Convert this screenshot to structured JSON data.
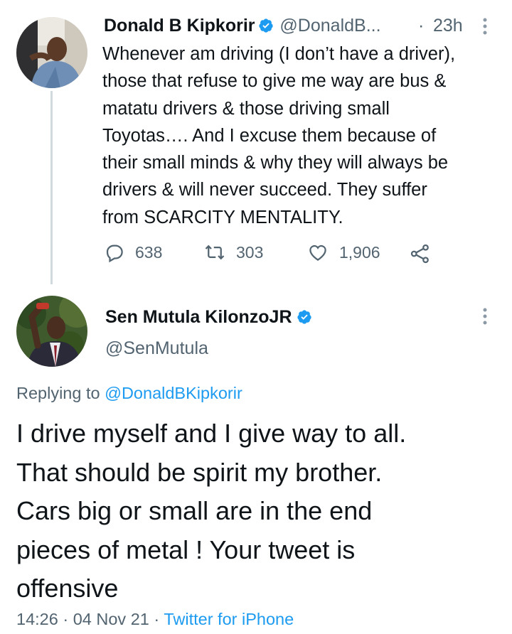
{
  "tweet1": {
    "display_name": "Donald B Kipkorir",
    "handle": "@DonaldB...",
    "separator": "·",
    "time": "23h",
    "body_lines": [
      "Whenever am driving (I don’t have a driver),",
      "those that refuse to give me way are bus &",
      "matatu drivers & those driving small",
      "Toyotas…. And I excuse them because of",
      "their small minds & why they will always be",
      "drivers & will never succeed. They suffer",
      "from SCARCITY MENTALITY."
    ],
    "reply_count": "638",
    "retweet_count": "303",
    "like_count": "1,906"
  },
  "tweet2": {
    "display_name": "Sen Mutula KilonzoJR",
    "handle": "@SenMutula",
    "replying_prefix": "Replying to",
    "replying_to": "@DonaldBKipkorir",
    "body_lines": [
      "I drive myself and I give way to all.",
      "That should be spirit my brother.",
      "Cars big or small are in the end",
      "pieces of metal ! Your tweet is",
      "offensive"
    ],
    "time": "14:26",
    "date": "04 Nov 21",
    "source": "Twitter for iPhone",
    "dot": "·"
  },
  "colors": {
    "verified": "#1d9bf0",
    "link": "#1d9bf0",
    "secondary_text": "#536471",
    "thread_line": "#cfd9de"
  },
  "icons": [
    "verified-badge-icon",
    "more-options-icon",
    "reply-icon",
    "retweet-icon",
    "like-icon",
    "share-icon"
  ]
}
